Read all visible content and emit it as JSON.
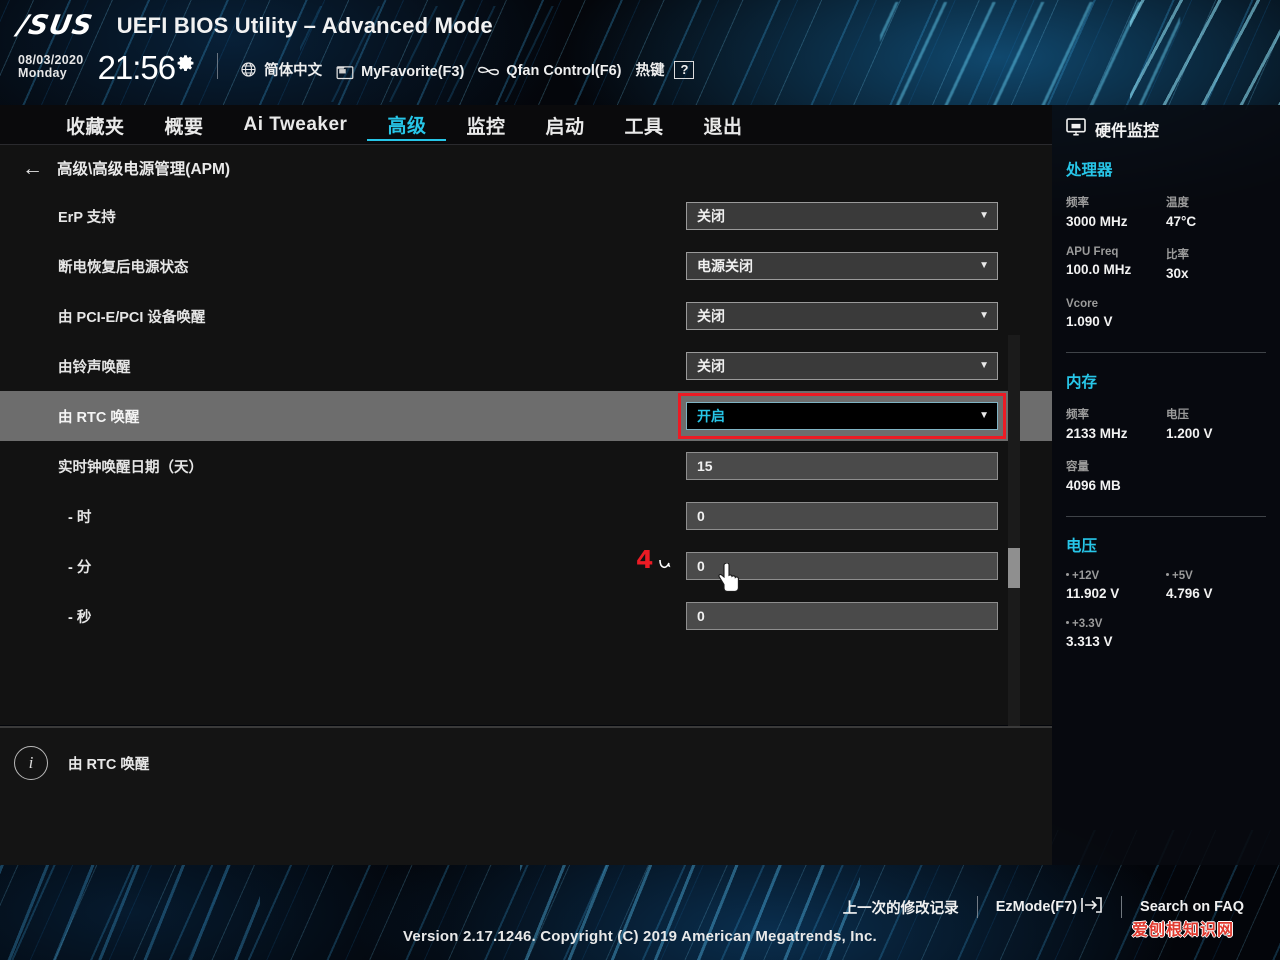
{
  "header": {
    "brand": "/SUS",
    "title": "UEFI BIOS Utility – Advanced Mode",
    "date": "08/03/2020",
    "weekday": "Monday",
    "time": "21:56",
    "gear_icon": "gear-icon",
    "items": [
      {
        "icon": "globe-icon",
        "label": "简体中文"
      },
      {
        "icon": "folder-icon",
        "label": "MyFavorite(F3)"
      },
      {
        "icon": "fan-icon",
        "label": "Qfan Control(F6)"
      },
      {
        "icon": "hotkey-icon",
        "label": "热键",
        "key": "?"
      }
    ]
  },
  "nav": {
    "tabs": [
      {
        "label": "收藏夹",
        "active": false
      },
      {
        "label": "概要",
        "active": false
      },
      {
        "label": "Ai Tweaker",
        "active": false
      },
      {
        "label": "高级",
        "active": true
      },
      {
        "label": "监控",
        "active": false
      },
      {
        "label": "启动",
        "active": false
      },
      {
        "label": "工具",
        "active": false
      },
      {
        "label": "退出",
        "active": false
      }
    ]
  },
  "main": {
    "breadcrumb": "高级\\高级电源管理(APM)",
    "back_icon": "arrow-left-icon",
    "rows": [
      {
        "label": "ErP 支持",
        "value": "关闭",
        "type": "select",
        "selected": false,
        "indent": false
      },
      {
        "label": "断电恢复后电源状态",
        "value": "电源关闭",
        "type": "select",
        "selected": false,
        "indent": false
      },
      {
        "label": "由 PCI-E/PCI 设备唤醒",
        "value": "关闭",
        "type": "select",
        "selected": false,
        "indent": false
      },
      {
        "label": "由铃声唤醒",
        "value": "关闭",
        "type": "select",
        "selected": false,
        "indent": false
      },
      {
        "label": "由 RTC 唤醒",
        "value": "开启",
        "type": "select",
        "selected": true,
        "indent": false
      },
      {
        "label": "实时钟唤醒日期（天）",
        "value": "15",
        "type": "number",
        "selected": false,
        "indent": false
      },
      {
        "label": "- 时",
        "value": "0",
        "type": "number",
        "selected": false,
        "indent": true
      },
      {
        "label": "- 分",
        "value": "0",
        "type": "number",
        "selected": false,
        "indent": true
      },
      {
        "label": "- 秒",
        "value": "0",
        "type": "number",
        "selected": false,
        "indent": true
      }
    ],
    "annotation": {
      "step": "4",
      "arrow_icon": "curved-arrow-icon",
      "cursor_icon": "hand-cursor-icon",
      "highlight_color": "#ec1b24"
    }
  },
  "help": {
    "icon": "info-icon",
    "text": "由 RTC 唤醒"
  },
  "sidebar": {
    "icon": "monitor-icon",
    "title": "硬件监控",
    "accent_color": "#27c6e8",
    "sections": [
      {
        "name": "处理器",
        "pairs": [
          {
            "key": "频率",
            "value": "3000 MHz"
          },
          {
            "key": "温度",
            "value": "47°C"
          },
          {
            "key": "APU Freq",
            "value": "100.0 MHz"
          },
          {
            "key": "比率",
            "value": "30x"
          },
          {
            "key": "Vcore",
            "value": "1.090 V"
          }
        ]
      },
      {
        "name": "内存",
        "pairs": [
          {
            "key": "频率",
            "value": "2133 MHz"
          },
          {
            "key": "电压",
            "value": "1.200 V"
          },
          {
            "key": "容量",
            "value": "4096 MB"
          }
        ]
      },
      {
        "name": "电压",
        "pairs": [
          {
            "key": "+12V",
            "value": "11.902 V"
          },
          {
            "key": "+5V",
            "value": "4.796 V"
          },
          {
            "key": "+3.3V",
            "value": "3.313 V"
          }
        ]
      }
    ]
  },
  "bottom": {
    "last_modified": "上一次的修改记录",
    "ezmode": "EzMode(F7)",
    "ezmode_key_icon": "arrow-into-box-icon",
    "search_faq": "Search on FAQ",
    "version": "Version 2.17.1246. Copyright (C) 2019 American Megatrends, Inc.",
    "watermark": "爱刨根知识网"
  }
}
